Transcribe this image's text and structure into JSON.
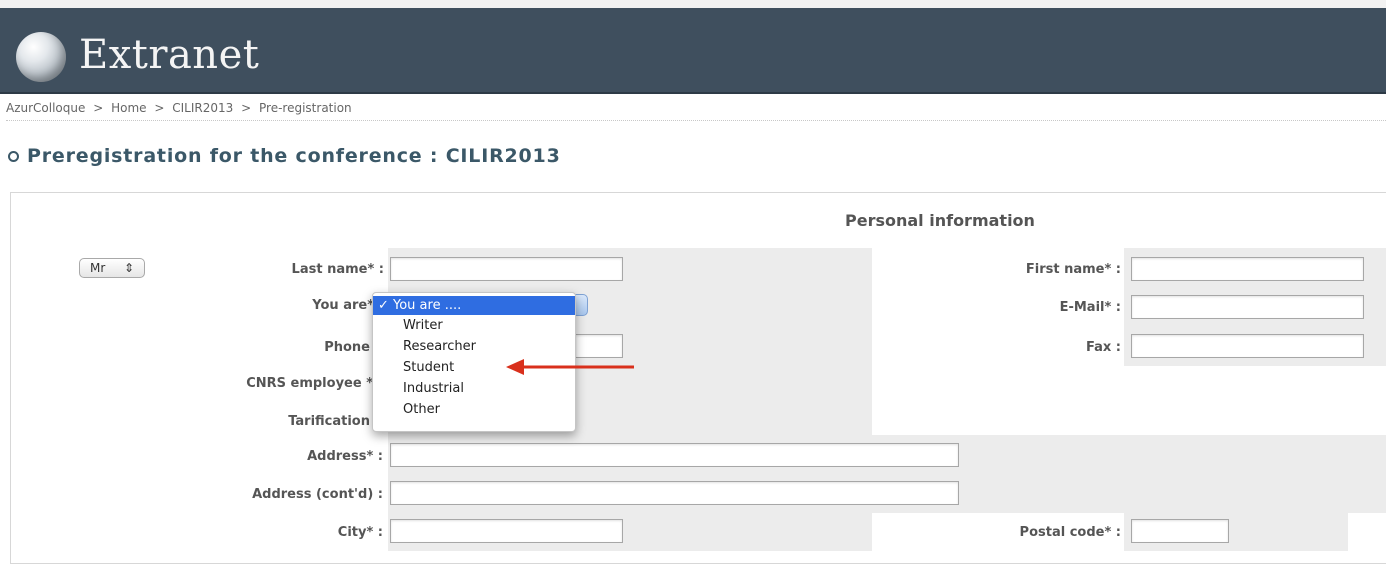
{
  "header": {
    "title": "Extranet",
    "logo_icon": "globe-logo-icon"
  },
  "breadcrumb": {
    "items": [
      "AzurColloque",
      "Home",
      "CILIR2013",
      "Pre-registration"
    ],
    "separator": ">"
  },
  "page": {
    "title": "Preregistration for the conference : CILIR2013"
  },
  "form": {
    "section_title": "Personal information",
    "civility": {
      "value": "Mr",
      "arrows": "⇕"
    },
    "last_name": {
      "label": "Last name* :",
      "value": ""
    },
    "you_are": {
      "label": "You are*",
      "selected": "You are ....",
      "check": "✓",
      "options": [
        "Writer",
        "Researcher",
        "Student",
        "Industrial",
        "Other"
      ]
    },
    "phone": {
      "label": "Phone",
      "value": ""
    },
    "cnrs": {
      "label": "CNRS employee *"
    },
    "tarification": {
      "label": "Tarification"
    },
    "address": {
      "label": "Address* :",
      "value": ""
    },
    "address2": {
      "label": "Address (cont'd) :",
      "value": ""
    },
    "city": {
      "label": "City* :",
      "value": ""
    },
    "first_name": {
      "label": "First name* :",
      "value": ""
    },
    "email": {
      "label": "E-Mail* :",
      "value": ""
    },
    "fax": {
      "label": "Fax :",
      "value": ""
    },
    "postal_code": {
      "label": "Postal code* :",
      "value": ""
    }
  },
  "colors": {
    "header_bg": "#3f4f5e",
    "title_color": "#3b5868",
    "selected_option_bg": "#2f6de1",
    "annotation_arrow": "#d9301c"
  }
}
